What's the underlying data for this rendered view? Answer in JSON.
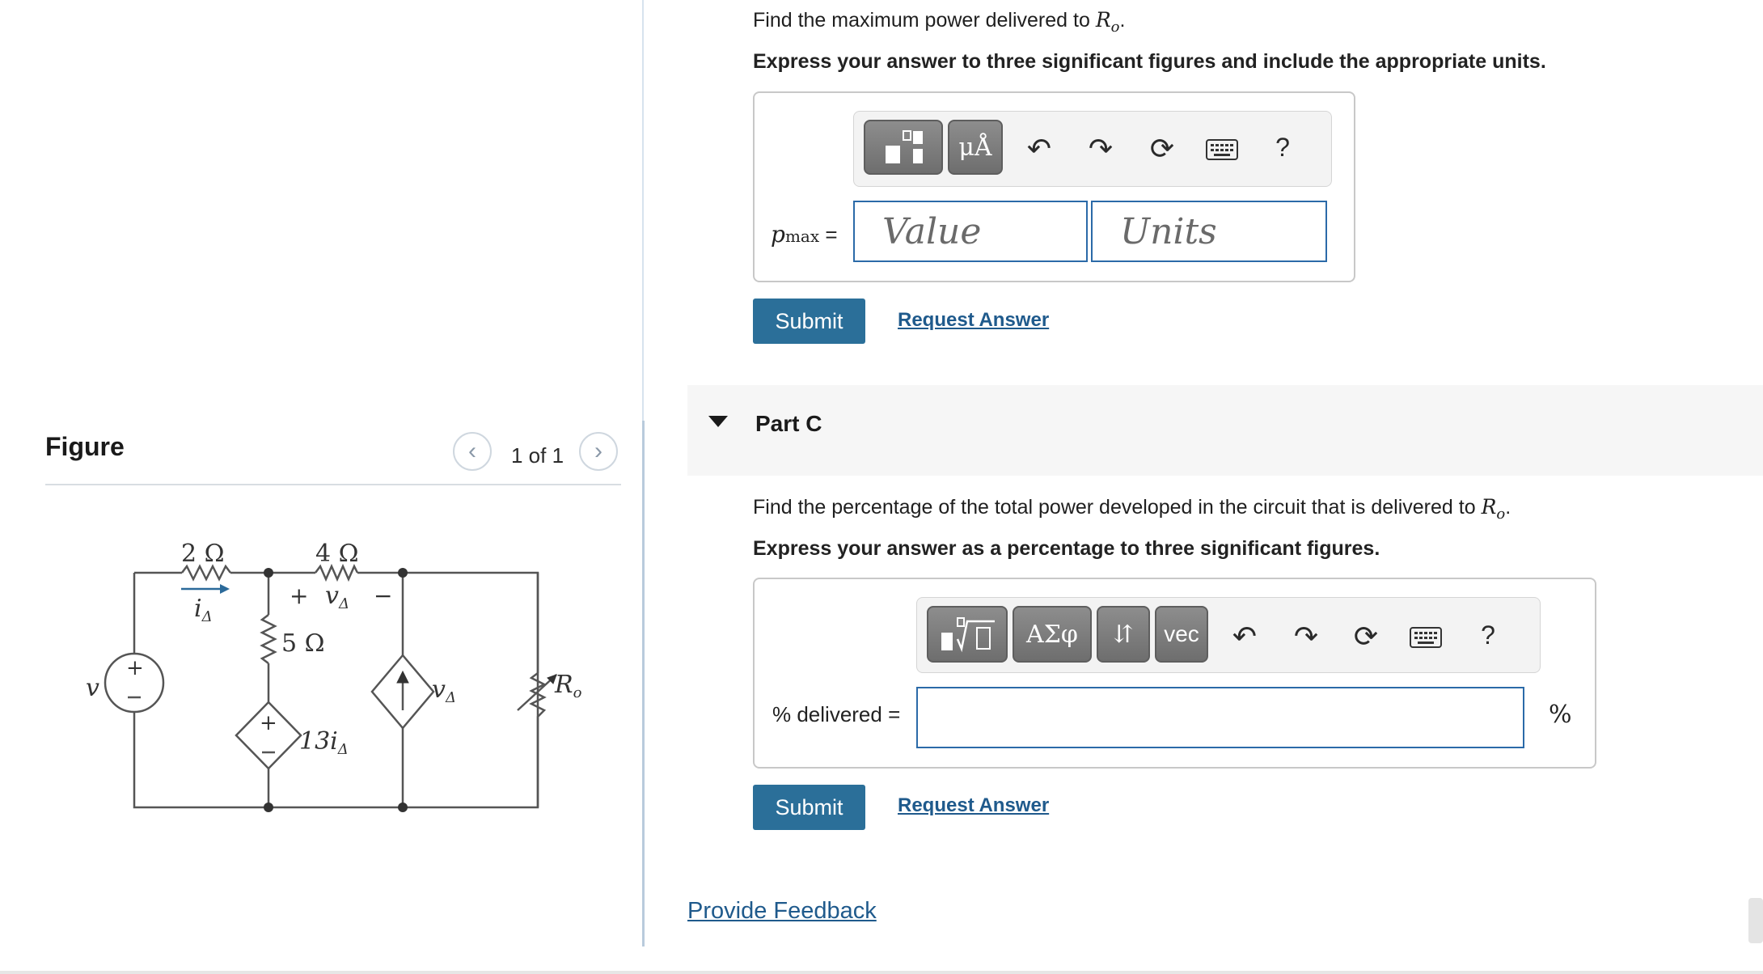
{
  "figure": {
    "title": "Figure",
    "page_count": "1 of 1",
    "prev_icon": "chevron-left-icon",
    "next_icon": "chevron-right-icon",
    "circuit": {
      "r1": "2 Ω",
      "r2": "4 Ω",
      "r3": "5 Ω",
      "ia": "i",
      "ia_sub": "Δ",
      "va_plus": "+",
      "va": "v",
      "va_sub": "Δ",
      "va_minus": "−",
      "v_source": "v",
      "dep_v": "13i",
      "dep_v_sub": "Δ",
      "dep_i": "v",
      "dep_i_sub": "Δ",
      "ro": "R",
      "ro_sub": "o"
    }
  },
  "partB": {
    "question": "Find the maximum power delivered to",
    "question_var": "R",
    "question_var_sub": "o",
    "question_end": ".",
    "instruction": "Express your answer to three significant figures and include the appropriate units.",
    "toolbar": {
      "templates_icon": "templates-icon",
      "units_button": "μÅ",
      "undo_icon": "undo-icon",
      "redo_icon": "redo-icon",
      "reset_icon": "reset-icon",
      "keyboard_icon": "keyboard-icon",
      "help": "?"
    },
    "label_var": "p",
    "label_sub": "max",
    "label_eq": "=",
    "value_placeholder": "Value",
    "units_placeholder": "Units",
    "submit": "Submit",
    "request": "Request Answer"
  },
  "partC": {
    "title": "Part C",
    "question": "Find the percentage of the total power developed in the circuit that is delivered to",
    "question_var": "R",
    "question_var_sub": "o",
    "question_end": ".",
    "instruction": "Express your answer as a percentage to three significant figures.",
    "toolbar": {
      "templates_icon": "templates-sqrt-icon",
      "greek_button": "ΑΣφ",
      "arrows_button": "⇵",
      "vec_button": "vec",
      "undo_icon": "undo-icon",
      "redo_icon": "redo-icon",
      "reset_icon": "reset-icon",
      "keyboard_icon": "keyboard-icon",
      "help": "?"
    },
    "label": "% delivered =",
    "input_value": "",
    "unit": "%",
    "submit": "Submit",
    "request": "Request Answer"
  },
  "feedback": "Provide Feedback"
}
